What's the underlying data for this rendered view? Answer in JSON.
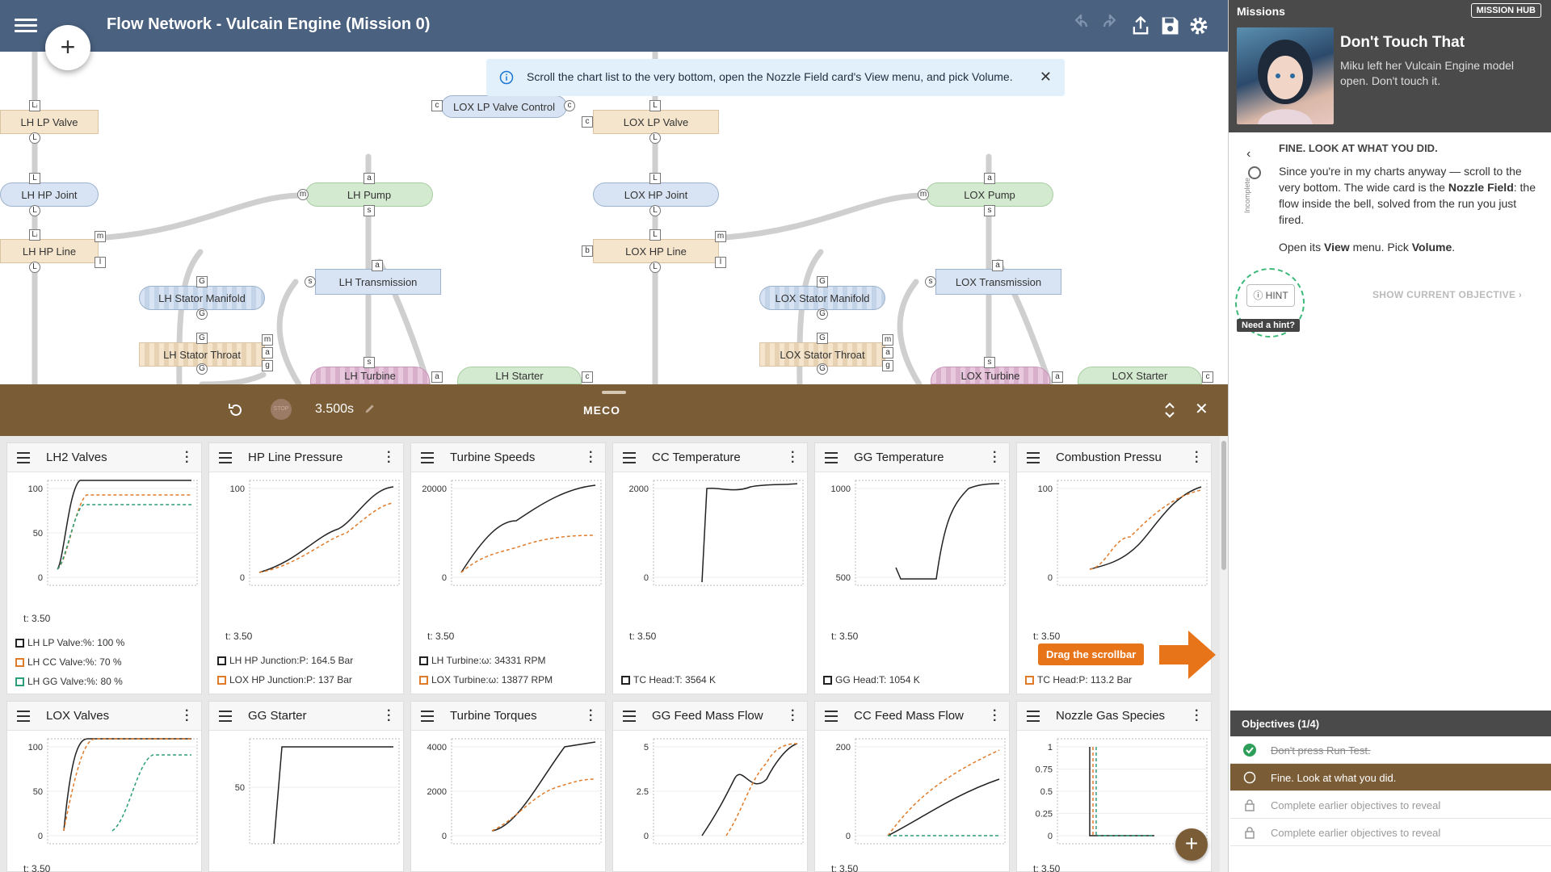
{
  "header": {
    "title": "Flow Network - Vulcain Engine (Mission 0)"
  },
  "banner": {
    "text": "Scroll the chart list to the very bottom, open the Nozzle Field card's View menu, and pick Volume."
  },
  "canvas": {
    "nodes": [
      "LH LP Valve",
      "LH HP Joint",
      "LH HP Line",
      "LH Pump",
      "LH Transmission",
      "LH Stator Manifold",
      "LH Stator Throat",
      "LH Turbine",
      "LH Starter",
      "LOX LP Valve Control",
      "LOX LP Valve",
      "LOX HP Joint",
      "LOX HP Line",
      "LOX Pump",
      "LOX Transmission",
      "LOX Stator Manifold",
      "LOX Stator Throat",
      "LOX Turbine",
      "LOX Starter"
    ]
  },
  "panel": {
    "time": "3.500s",
    "logo": "MECO",
    "stop": "STOP"
  },
  "charts": [
    {
      "title": "LH2 Valves",
      "t": "t:  3.50",
      "yticks": [
        "100",
        "50",
        "0"
      ],
      "legend": [
        {
          "label": "LH LP Valve:%:  100 %",
          "color": "#222"
        },
        {
          "label": "LH CC Valve:%:  70 %",
          "color": "#e07b2a"
        },
        {
          "label": "LH GG Valve:%:  80 %",
          "color": "#2a9d7a"
        }
      ]
    },
    {
      "title": "HP Line Pressure",
      "t": "t:  3.50",
      "yticks": [
        "100",
        "0"
      ],
      "legend": [
        {
          "label": "LH HP Junction:P:  164.5 Bar",
          "color": "#222"
        },
        {
          "label": "LOX HP Junction:P:  137 Bar",
          "color": "#e07b2a"
        }
      ]
    },
    {
      "title": "Turbine Speeds",
      "t": "t:  3.50",
      "yticks": [
        "20000",
        "0"
      ],
      "legend": [
        {
          "label": "LH Turbine:ω:  34331 RPM",
          "color": "#222"
        },
        {
          "label": "LOX Turbine:ω:  13877 RPM",
          "color": "#e07b2a"
        }
      ]
    },
    {
      "title": "CC Temperature",
      "t": "t:  3.50",
      "yticks": [
        "2000",
        "0"
      ],
      "legend": [
        {
          "label": "TC Head:T:  3564 K",
          "color": "#222"
        }
      ]
    },
    {
      "title": "GG Temperature",
      "t": "t:  3.50",
      "yticks": [
        "1000",
        "500"
      ],
      "legend": [
        {
          "label": "GG Head:T:  1054 K",
          "color": "#222"
        }
      ]
    },
    {
      "title": "Combustion Pressu",
      "t": "t:  3.50",
      "yticks": [
        "100",
        "0"
      ],
      "legend": [
        {
          "label": "TC Head:P:  113.2 Bar",
          "color": "#e07b2a"
        }
      ]
    },
    {
      "title": "LOX Valves",
      "t": "t:  3.50",
      "yticks": [
        "100",
        "50",
        "0"
      ],
      "legend": []
    },
    {
      "title": "GG Starter",
      "t": "",
      "yticks": [
        "50"
      ],
      "legend": []
    },
    {
      "title": "Turbine Torques",
      "t": "",
      "yticks": [
        "4000",
        "2000",
        "0"
      ],
      "legend": []
    },
    {
      "title": "GG Feed Mass Flow",
      "t": "",
      "yticks": [
        "5",
        "2.5",
        "0"
      ],
      "legend": []
    },
    {
      "title": "CC Feed Mass Flow",
      "t": "t:  3.50",
      "yticks": [
        "200",
        "0"
      ],
      "legend": []
    },
    {
      "title": "Nozzle Gas Species",
      "t": "t:  3.50",
      "yticks": [
        "1",
        "0.75",
        "0.5",
        "0.25",
        "0"
      ],
      "legend": []
    }
  ],
  "drag_badge": "Drag the scrollbar",
  "sidebar": {
    "header": "Missions",
    "hub_button": "MISSION HUB",
    "mission_title": "Don't Touch That",
    "mission_desc": "Miku left her Vulcain Engine model open. Don't touch it.",
    "objective_status": "Incomplete",
    "objective_title": "FINE. LOOK AT WHAT YOU DID.",
    "objective_body_1": "Since you're in my charts anyway — scroll to the very bottom. The wide card is the ",
    "objective_body_bold1": "Nozzle Field",
    "objective_body_2": ": the flow inside the bell, solved from the run you just fired.",
    "objective_line2_a": "Open its ",
    "objective_line2_b": "View",
    "objective_line2_c": " menu. Pick ",
    "objective_line2_d": "Volume",
    "objective_line2_e": ".",
    "hint": "HINT",
    "need_hint": "Need a hint?",
    "show_objective": "SHOW CURRENT OBJECTIVE",
    "objectives_header": "Objectives (1/4)",
    "objectives": [
      {
        "label": "Don't press Run Test.",
        "state": "done"
      },
      {
        "label": "Fine. Look at what you did.",
        "state": "active"
      },
      {
        "label": "Complete earlier objectives to reveal",
        "state": "locked"
      },
      {
        "label": "Complete earlier objectives to reveal",
        "state": "locked"
      }
    ]
  }
}
